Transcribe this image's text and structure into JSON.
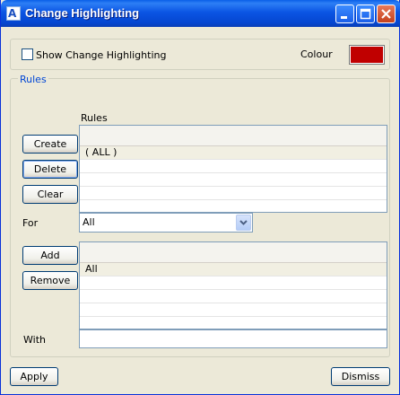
{
  "window": {
    "title": "Change Highlighting"
  },
  "top": {
    "show_label": "Show Change Highlighting",
    "show_checked": false,
    "colour_label": "Colour",
    "colour_value": "#c00000"
  },
  "rules_group": {
    "legend": "Rules",
    "rules_list_label": "Rules",
    "rules": [
      "( ALL )"
    ],
    "buttons": {
      "create": "Create",
      "delete": "Delete",
      "clear": "Clear"
    },
    "for_label": "For",
    "for_value": "All",
    "with_buttons": {
      "add": "Add",
      "remove": "Remove"
    },
    "with_items": [
      "All"
    ],
    "with_label": "With",
    "with_value": ""
  },
  "footer": {
    "apply": "Apply",
    "dismiss": "Dismiss"
  }
}
